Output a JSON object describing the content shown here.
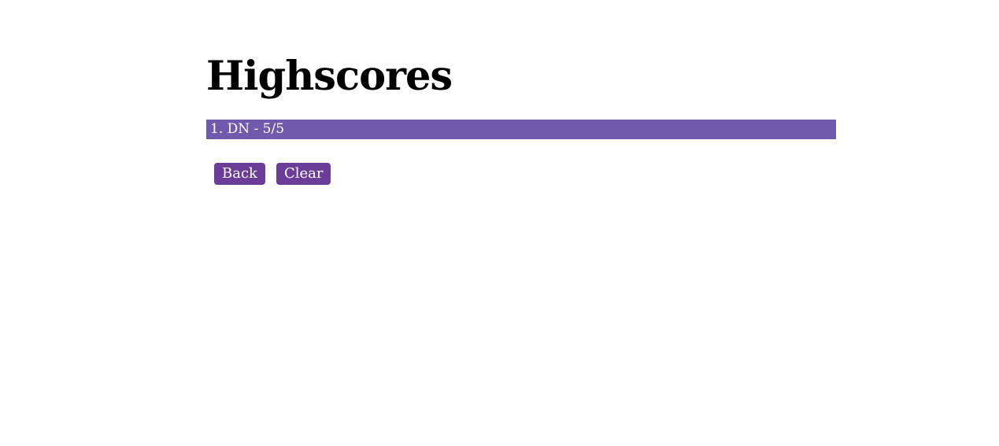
{
  "page": {
    "title": "Highscores"
  },
  "highscores": {
    "entries": [
      "1. DN - 5/5"
    ]
  },
  "actions": {
    "back_label": "Back",
    "clear_label": "Clear"
  },
  "colors": {
    "list_background": "#7159ad",
    "button_background": "#6b3d98",
    "text_light": "#ffffff",
    "text_dark": "#000000"
  }
}
